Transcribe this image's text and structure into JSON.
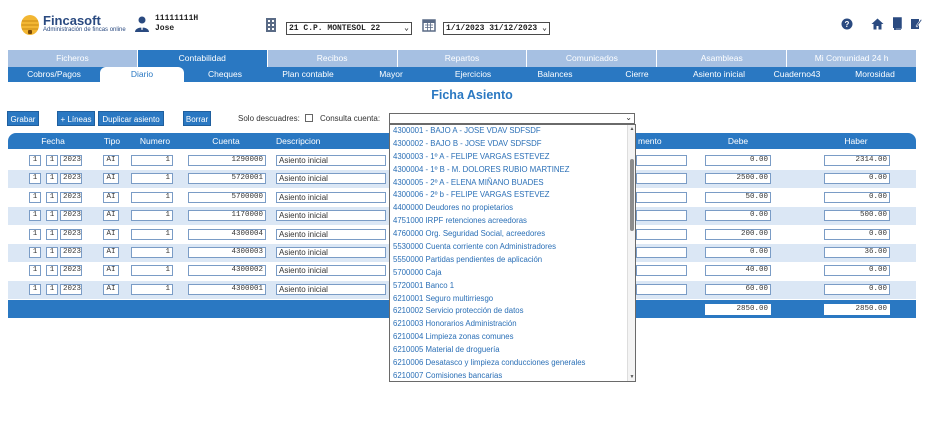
{
  "app": {
    "name": "Fincasoft",
    "tagline": "Administración de fincas online"
  },
  "user": {
    "id": "11111111H",
    "name": "Jose"
  },
  "community_select": {
    "value": "21 C.P. MONTESOL 22"
  },
  "date_range_select": {
    "value": "1/1/2023  31/12/2023"
  },
  "colors": {
    "primary": "#2a78c2",
    "primary_light": "#a6c0e2",
    "row_alt": "#dbe7f5",
    "link": "#2a6fb6"
  },
  "header_icons": [
    "building-icon",
    "calendar-icon",
    "help-icon",
    "home-icon",
    "book-icon",
    "edit-icon"
  ],
  "main_tabs": [
    {
      "label": "Ficheros",
      "active": false
    },
    {
      "label": "Contabilidad",
      "active": true
    },
    {
      "label": "Recibos",
      "active": false
    },
    {
      "label": "Repartos",
      "active": false
    },
    {
      "label": "Comunicados",
      "active": false
    },
    {
      "label": "Asambleas",
      "active": false
    },
    {
      "label": "Mi Comunidad 24 h",
      "active": false
    }
  ],
  "sub_tabs": [
    {
      "label": "Cobros/Pagos",
      "active": false
    },
    {
      "label": "Diario",
      "active": true
    },
    {
      "label": "Cheques",
      "active": false
    },
    {
      "label": "Plan contable",
      "active": false
    },
    {
      "label": "Mayor",
      "active": false
    },
    {
      "label": "Ejercicios",
      "active": false
    },
    {
      "label": "Balances",
      "active": false
    },
    {
      "label": "Cierre",
      "active": false
    },
    {
      "label": "Asiento inicial",
      "active": false
    },
    {
      "label": "Cuaderno43",
      "active": false
    },
    {
      "label": "Morosidad",
      "active": false
    }
  ],
  "page_title": "Ficha Asiento",
  "toolbar": {
    "grabar": "Grabar",
    "add_lines": "+ Líneas",
    "duplicate": "Duplicar asiento",
    "delete": "Borrar",
    "solo_descuadres": "Solo descuadres:",
    "solo_descuadres_checked": false,
    "consulta_cuenta": "Consulta cuenta:",
    "consulta_value": ""
  },
  "table": {
    "headers": {
      "fecha": "Fecha",
      "tipo": "Tipo",
      "numero": "Numero",
      "cuenta": "Cuenta",
      "descripcion": "Descripcion",
      "documento": "mento",
      "debe": "Debe",
      "haber": "Haber"
    },
    "rows": [
      {
        "day": "1",
        "month": "1",
        "year": "2023",
        "tipo": "AI",
        "numero": "1",
        "cuenta": "1290000",
        "descripcion": "Asiento inicial",
        "debe": "0.00",
        "haber": "2314.00"
      },
      {
        "day": "1",
        "month": "1",
        "year": "2023",
        "tipo": "AI",
        "numero": "1",
        "cuenta": "5720001",
        "descripcion": "Asiento inicial",
        "debe": "2500.00",
        "haber": "0.00"
      },
      {
        "day": "1",
        "month": "1",
        "year": "2023",
        "tipo": "AI",
        "numero": "1",
        "cuenta": "5700000",
        "descripcion": "Asiento inicial",
        "debe": "50.00",
        "haber": "0.00"
      },
      {
        "day": "1",
        "month": "1",
        "year": "2023",
        "tipo": "AI",
        "numero": "1",
        "cuenta": "1170000",
        "descripcion": "Asiento inicial",
        "debe": "0.00",
        "haber": "500.00"
      },
      {
        "day": "1",
        "month": "1",
        "year": "2023",
        "tipo": "AI",
        "numero": "1",
        "cuenta": "4300004",
        "descripcion": "Asiento inicial",
        "debe": "200.00",
        "haber": "0.00"
      },
      {
        "day": "1",
        "month": "1",
        "year": "2023",
        "tipo": "AI",
        "numero": "1",
        "cuenta": "4300003",
        "descripcion": "Asiento inicial",
        "debe": "0.00",
        "haber": "36.00"
      },
      {
        "day": "1",
        "month": "1",
        "year": "2023",
        "tipo": "AI",
        "numero": "1",
        "cuenta": "4300002",
        "descripcion": "Asiento inicial",
        "debe": "40.00",
        "haber": "0.00"
      },
      {
        "day": "1",
        "month": "1",
        "year": "2023",
        "tipo": "AI",
        "numero": "1",
        "cuenta": "4300001",
        "descripcion": "Asiento inicial",
        "debe": "60.00",
        "haber": "0.00"
      }
    ],
    "totals": {
      "debe": "2850.00",
      "haber": "2850.00"
    }
  },
  "account_dropdown": {
    "options": [
      "4300001 - BAJO A - JOSE VDAV SDFSDF",
      "4300002 - BAJO B - JOSE VDAV SDFSDF",
      "4300003 - 1º A - FELIPE VARGAS ESTEVEZ",
      "4300004 - 1º B - M. DOLORES RUBIO MARTINEZ",
      "4300005 - 2º A - ELENA MIÑANO BUADES",
      "4300006 - 2º b - FELIPE VARGAS ESTEVEZ",
      "4400000 Deudores no propietarios",
      "4751000 IRPF retenciones acreedoras",
      "4760000 Org. Seguridad Social, acreedores",
      "5530000 Cuenta corriente con Administradores",
      "5550000 Partidas pendientes de aplicación",
      "5700000 Caja",
      "5720001 Banco 1",
      "6210001 Seguro multirriesgo",
      "6210002 Servicio protección de datos",
      "6210003 Honorarios Administración",
      "6210004 Limpieza zonas comunes",
      "6210005 Material de droguería",
      "6210006 Desatasco y limpieza conducciones generales",
      "6210007 Comisiones bancarias"
    ]
  }
}
